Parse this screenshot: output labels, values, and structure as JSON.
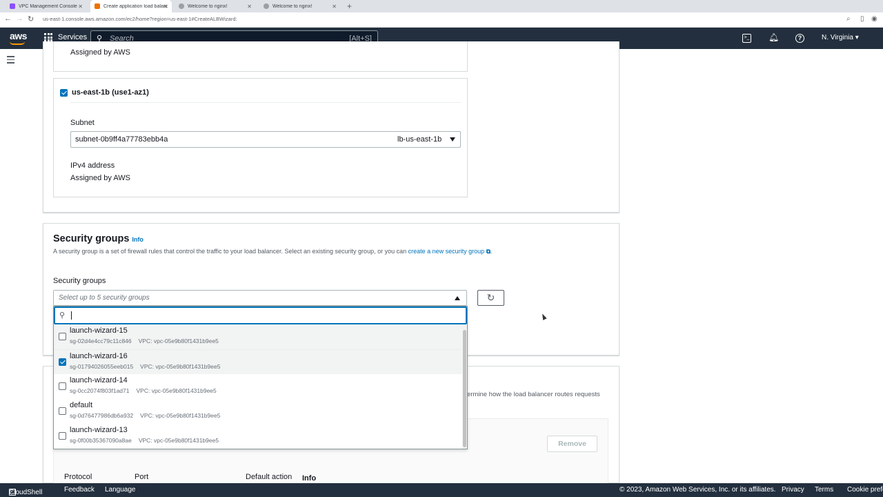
{
  "browser": {
    "tabs": [
      {
        "label": "VPC Management Console",
        "fav": "#8c4fff"
      },
      {
        "label": "Create application load balancer",
        "fav": "#ed7100"
      },
      {
        "label": "Welcome to nginx!",
        "fav": "#9aa0a6"
      },
      {
        "label": "Welcome to nginx!",
        "fav": "#9aa0a6"
      }
    ],
    "url": "us-east-1.console.aws.amazon.com/ec2/home?region=us-east-1#CreateALBWizard:"
  },
  "nav": {
    "logo": "aws",
    "services": "Services",
    "search_placeholder": "Search",
    "search_shortcut": "[Alt+S]",
    "region": "N. Virginia ▾",
    "icons": [
      "cloudshell-icon",
      "bell-icon",
      "help-icon"
    ]
  },
  "mappings": {
    "top_value": "Assigned by AWS",
    "az_label": "us-east-1b (use1-az1)",
    "subnet_label": "Subnet",
    "subnet_value": "subnet-0b9ff4a77783ebb4a",
    "subnet_name": "lb-us-east-1b",
    "ipv4_label": "IPv4 address",
    "ipv4_value": "Assigned by AWS"
  },
  "security": {
    "title": "Security groups",
    "info": "Info",
    "description": "A security group is a set of firewall rules that control the traffic to your load balancer. Select an existing security group, or you can",
    "link": "create a new security group",
    "field_label": "Security groups",
    "placeholder": "Select up to 5 security groups",
    "options": [
      {
        "name": "launch-wizard-15",
        "id": "sg-02d4e4cc79c11c846",
        "vpc": "VPC: vpc-05e9b80f1431b9ee5",
        "checked": false
      },
      {
        "name": "launch-wizard-16",
        "id": "sg-01794026055eeb015",
        "vpc": "VPC: vpc-05e9b80f1431b9ee5",
        "checked": true
      },
      {
        "name": "launch-wizard-14",
        "id": "sg-0cc2074f803f1ad71",
        "vpc": "VPC: vpc-05e9b80f1431b9ee5",
        "checked": false
      },
      {
        "name": "default",
        "id": "sg-0d76477986db6a932",
        "vpc": "VPC: vpc-05e9b80f1431b9ee5",
        "checked": false
      },
      {
        "name": "launch-wizard-13",
        "id": "sg-0f00b35367090a8ae",
        "vpc": "VPC: vpc-05e9b80f1431b9ee5",
        "checked": false
      }
    ]
  },
  "listeners": {
    "partial_text": "ermine how the load balancer routes requests",
    "remove": "Remove",
    "col_protocol": "Protocol",
    "col_port": "Port",
    "col_default_action": "Default action",
    "info": "Info"
  },
  "footer": {
    "cloudshell": "CloudShell",
    "feedback": "Feedback",
    "language": "Language",
    "copyright": "© 2023, Amazon Web Services, Inc. or its affiliates.",
    "privacy": "Privacy",
    "terms": "Terms",
    "cookies": "Cookie prefere"
  }
}
